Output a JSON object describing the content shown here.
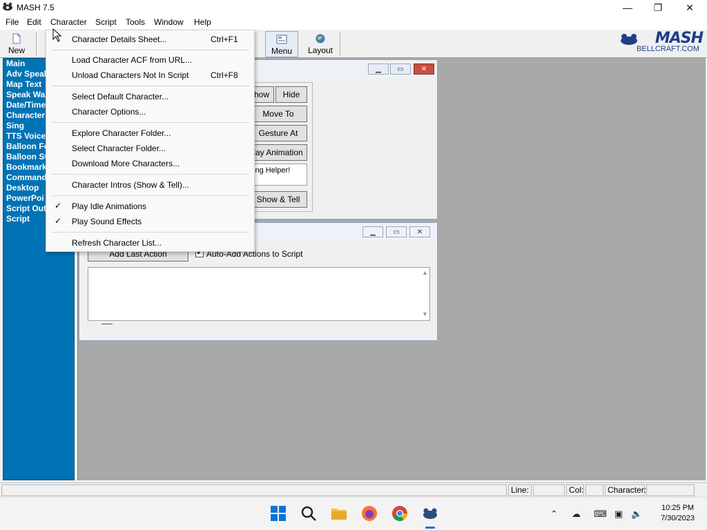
{
  "app": {
    "title": "MASH 7.5"
  },
  "window_controls": {
    "minimize": "—",
    "maximize": "❐",
    "close": "✕"
  },
  "menubar": [
    "File",
    "Edit",
    "Character",
    "Script",
    "Tools",
    "Window",
    "Help"
  ],
  "toolbar": {
    "new": "New",
    "menu": "Menu",
    "layout": "Layout"
  },
  "brand": {
    "logo": "MASH",
    "site": "BELLCRAFT.COM"
  },
  "left_panel": [
    "Main",
    "Adv Speak",
    "Map Text",
    "Speak Wa",
    "Date/Time",
    "Character",
    "Sing",
    "TTS Voice",
    "Balloon Fo",
    "Balloon St",
    "Bookmark",
    "Command",
    "Desktop",
    "PowerPoi",
    "Script Out",
    "Script"
  ],
  "main_window": {
    "buttons": {
      "show": "how",
      "hide": "Hide",
      "move_to": "Move To",
      "gesture_at": "Gesture At",
      "play_animation": "lay Animation",
      "show_tell": "Show & Tell"
    },
    "helper_text": "ting Helper!"
  },
  "script_window": {
    "add_last_action": "Add Last Action",
    "auto_add_label": "Auto-Add Actions to Script",
    "auto_add_checked": true
  },
  "dropdown": {
    "items": [
      {
        "label": "Character Details Sheet...",
        "shortcut": "Ctrl+F1",
        "checked": false
      },
      {
        "label": "Load Character ACF from URL...",
        "shortcut": "",
        "checked": false
      },
      {
        "label": "Unload Characters Not In Script",
        "shortcut": "Ctrl+F8",
        "checked": false
      },
      {
        "label": "Select Default Character...",
        "shortcut": "",
        "checked": false
      },
      {
        "label": "Character Options...",
        "shortcut": "",
        "checked": false
      },
      {
        "label": "Explore Character Folder...",
        "shortcut": "",
        "checked": false
      },
      {
        "label": "Select Character Folder...",
        "shortcut": "",
        "checked": false
      },
      {
        "label": "Download More Characters...",
        "shortcut": "",
        "checked": false
      },
      {
        "label": "Character Intros (Show & Tell)...",
        "shortcut": "",
        "checked": false
      },
      {
        "label": "Play Idle Animations",
        "shortcut": "",
        "checked": true
      },
      {
        "label": "Play Sound Effects",
        "shortcut": "",
        "checked": true
      },
      {
        "label": "Refresh Character List...",
        "shortcut": "",
        "checked": false
      }
    ],
    "check_glyph": "✓"
  },
  "statusbar": {
    "line_label": "Line:",
    "col_label": "Col:",
    "character_label": "Character:"
  },
  "clock": {
    "time": "10:25 PM",
    "date": "7/30/2023"
  },
  "colors": {
    "panel_blue": "#0073b5",
    "mdi_gray": "#a9a9a9",
    "brand_blue": "#1d3f87"
  }
}
